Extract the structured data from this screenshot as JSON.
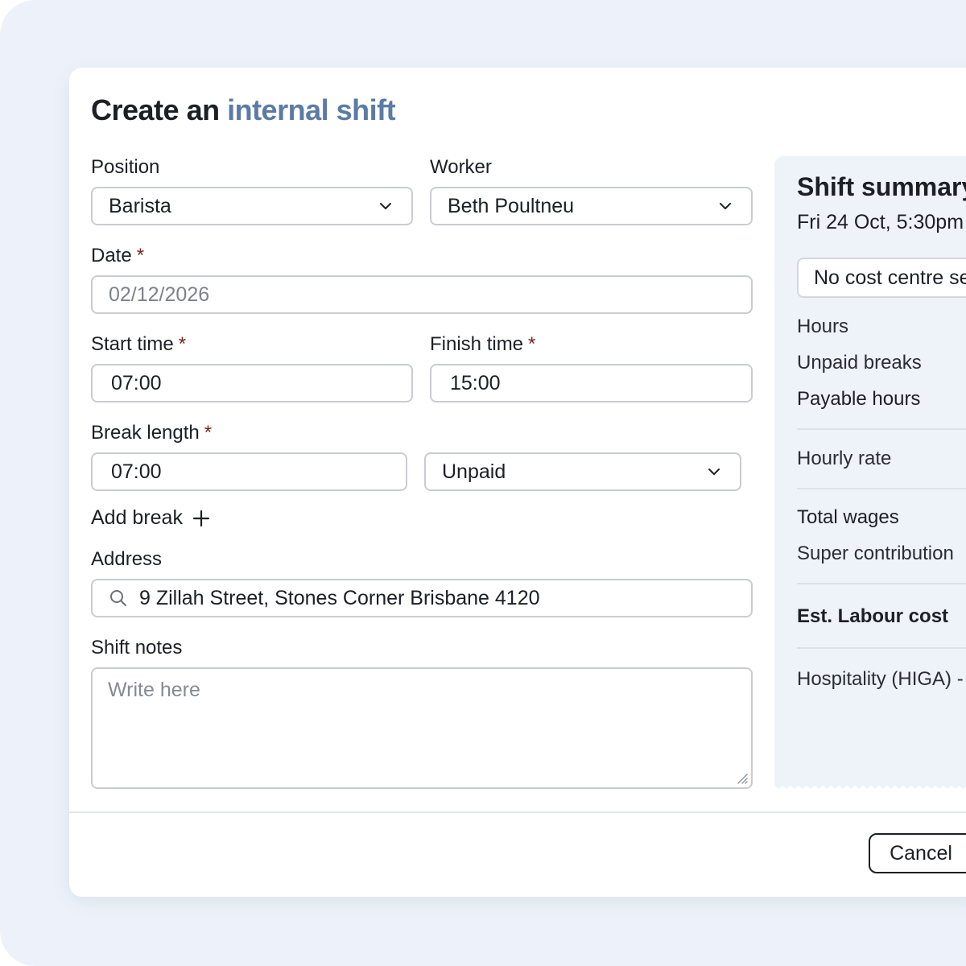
{
  "modal": {
    "title_prefix": "Create an ",
    "title_accent": "internal shift"
  },
  "form": {
    "position": {
      "label": "Position",
      "value": "Barista"
    },
    "worker": {
      "label": "Worker",
      "value": "Beth Poultneu"
    },
    "date": {
      "label": "Date",
      "required_mark": "*",
      "placeholder": "02/12/2026"
    },
    "start_time": {
      "label": "Start time",
      "required_mark": "*",
      "value": "07:00"
    },
    "finish_time": {
      "label": "Finish time",
      "required_mark": "*",
      "value": "15:00"
    },
    "break_length": {
      "label": "Break length",
      "required_mark": "*",
      "value": "07:00",
      "type_value": "Unpaid"
    },
    "add_break": {
      "label": "Add break",
      "icon": "plus-icon"
    },
    "address": {
      "label": "Address",
      "icon": "search-icon",
      "value": "9 Zillah Street, Stones Corner Brisbane 4120"
    },
    "shift_notes": {
      "label": "Shift notes",
      "placeholder": "Write here"
    }
  },
  "summary": {
    "title": "Shift summary",
    "date": "Fri 24 Oct, 5:30pm",
    "cost_centre": "No cost centre se",
    "rows": {
      "hours": "Hours",
      "unpaid_breaks": "Unpaid breaks",
      "payable_hours": "Payable hours",
      "hourly_rate": "Hourly rate",
      "total_wages": "Total wages",
      "super_contribution": "Super contribution",
      "est_labour_cost": "Est. Labour cost",
      "award": "Hospitality (HIGA) -"
    }
  },
  "footer": {
    "cancel_label": "Cancel"
  },
  "colors": {
    "background": "#edf2fa",
    "title_accent": "#5b7ba6",
    "required_mark": "#7a1f1f",
    "summary_panel": "#eef2f9"
  }
}
